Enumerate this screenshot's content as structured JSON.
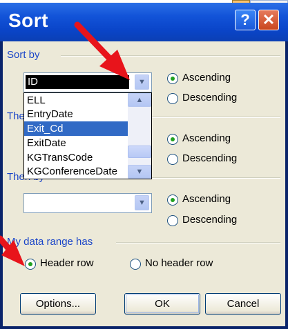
{
  "dialog": {
    "title": "Sort",
    "help_icon_glyph": "?",
    "close_icon_glyph": "✕"
  },
  "sort_by": {
    "group_label": "Sort by",
    "selected_value": "ID",
    "list_items": [
      "ELL",
      "EntryDate",
      "Exit_Cd",
      "ExitDate",
      "KGTransCode",
      "KGConferenceDate"
    ],
    "highlighted_item": "Exit_Cd",
    "ascending_label": "Ascending",
    "descending_label": "Descending",
    "selected_order": "Ascending"
  },
  "then_by_1": {
    "group_label": "Then by",
    "value": "",
    "ascending_label": "Ascending",
    "descending_label": "Descending",
    "selected_order": "Ascending"
  },
  "then_by_2": {
    "group_label": "Then by",
    "value": "",
    "ascending_label": "Ascending",
    "descending_label": "Descending",
    "selected_order": "Ascending"
  },
  "data_range": {
    "group_label": "My data range has",
    "header_row_label": "Header row",
    "no_header_row_label": "No header row",
    "selected": "Header row"
  },
  "buttons": {
    "options": "Options...",
    "ok": "OK",
    "cancel": "Cancel"
  },
  "colors": {
    "title_bar": "#0b45c9",
    "group_label_text": "#1a45c8",
    "list_selection": "#316ac5",
    "annotation_arrow": "#e8141b"
  }
}
